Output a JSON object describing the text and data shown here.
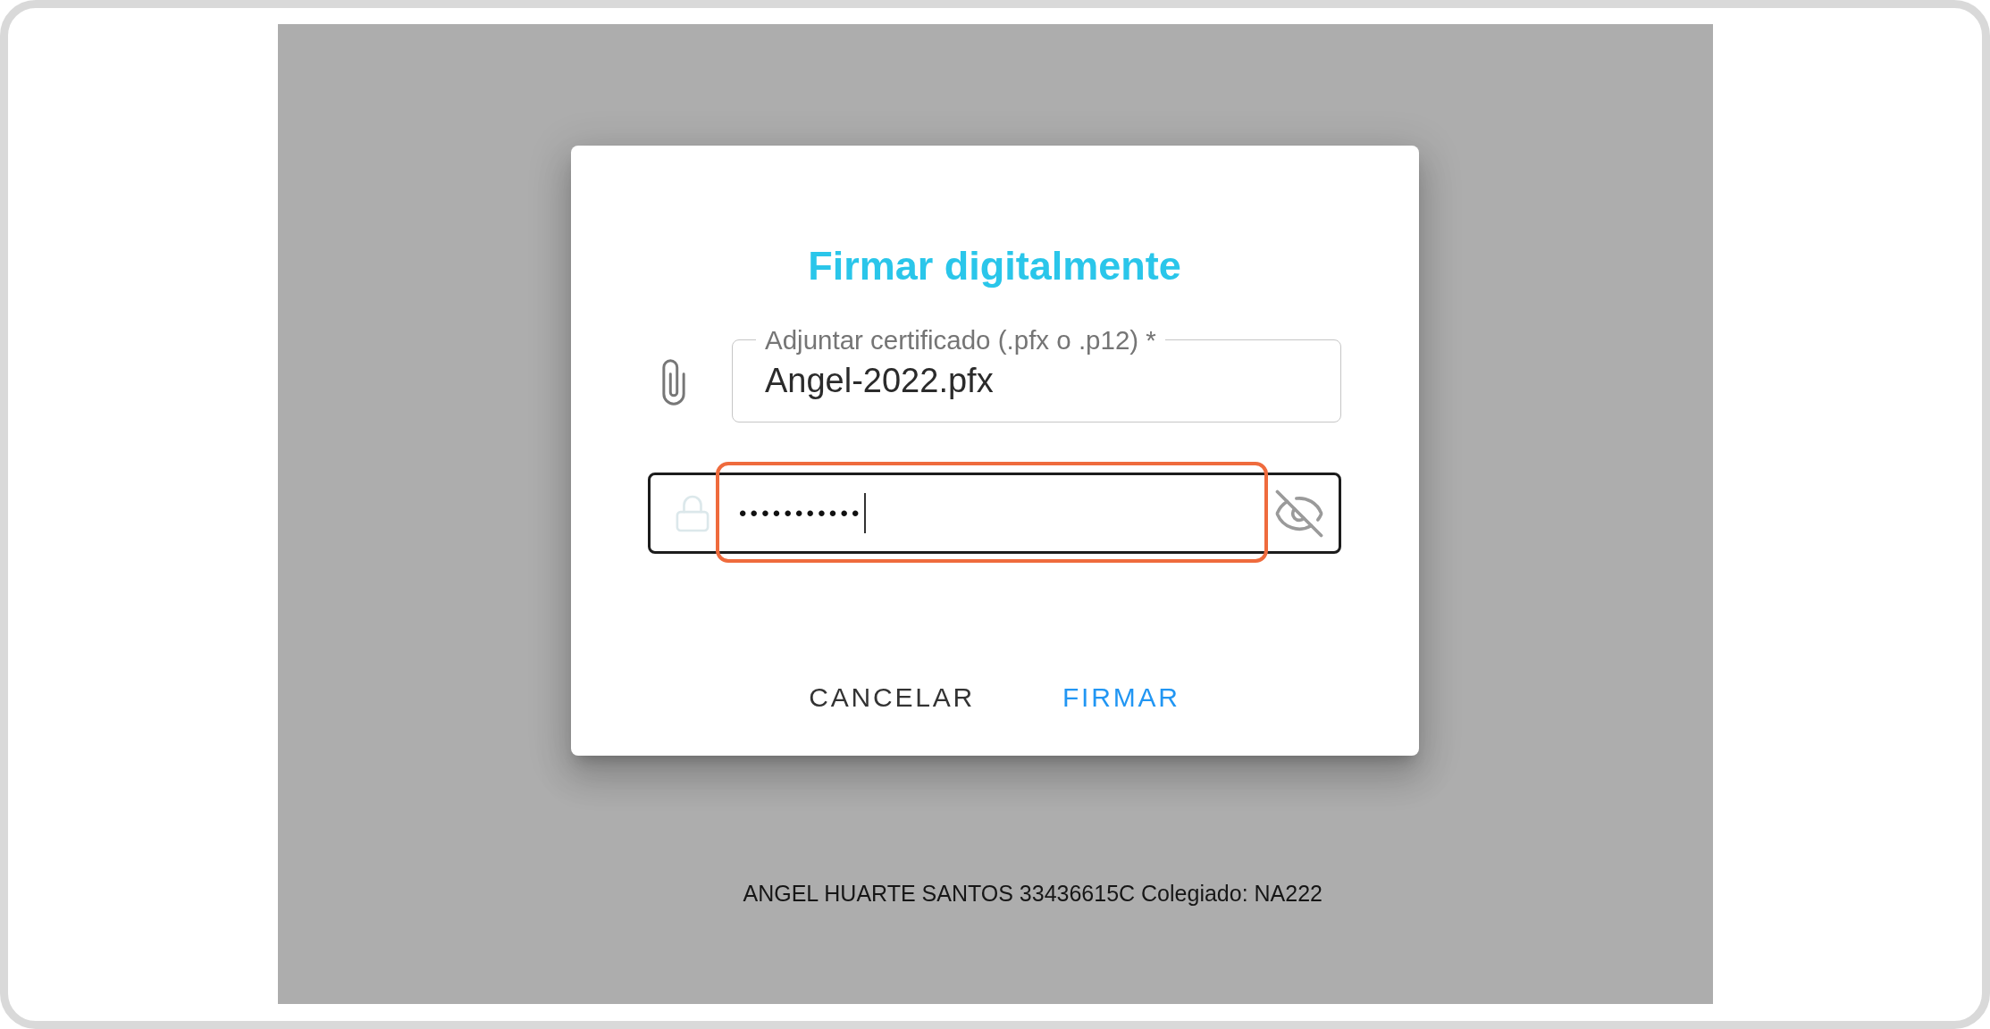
{
  "dialog": {
    "title": "Firmar digitalmente",
    "certificate_field": {
      "label": "Adjuntar certificado (.pfx o .p12) *",
      "value": "Angel-2022.pfx"
    },
    "password_field": {
      "value": "•••••••••••",
      "focused": true,
      "highlighted": true
    },
    "buttons": [
      {
        "label": "CANCELAR",
        "kind": "secondary"
      },
      {
        "label": "FIRMAR",
        "kind": "primary"
      }
    ]
  },
  "footer": "ANGEL HUARTE SANTOS 33436615C Colegiado: NA222"
}
